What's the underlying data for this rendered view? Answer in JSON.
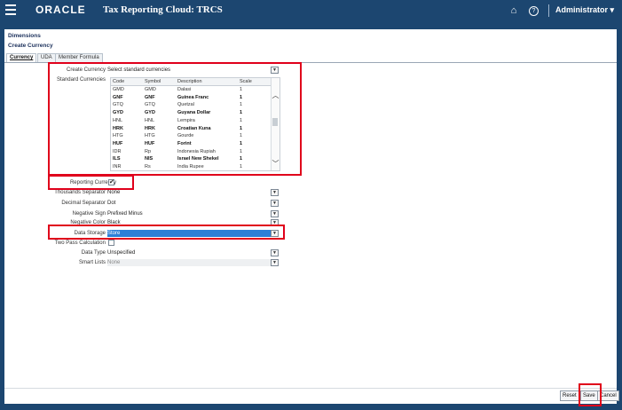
{
  "header": {
    "logo": "ORACLE",
    "app_title": "Tax Reporting Cloud: TRCS",
    "user": "Administrator ▾",
    "home_icon": "⌂",
    "help_icon": "?"
  },
  "page": {
    "section": "Dimensions",
    "title": "Create Currency"
  },
  "tabs": [
    "Currency",
    "UDA",
    "Member Formula"
  ],
  "form": {
    "create_currency_label": "Create Currency",
    "create_currency_value": "Select standard currencies",
    "standard_currencies_label": "Standard Currencies",
    "columns": [
      "Code",
      "Symbol",
      "Description",
      "Scale"
    ],
    "rows": [
      {
        "code": "GMD",
        "symbol": "GMD",
        "description": "Dalasi",
        "scale": "1",
        "bold": false
      },
      {
        "code": "GNF",
        "symbol": "GNF",
        "description": "Guinea Franc",
        "scale": "1",
        "bold": true
      },
      {
        "code": "GTQ",
        "symbol": "GTQ",
        "description": "Quetzal",
        "scale": "1",
        "bold": false
      },
      {
        "code": "GYD",
        "symbol": "GYD",
        "description": "Guyana Dollar",
        "scale": "1",
        "bold": true
      },
      {
        "code": "HNL",
        "symbol": "HNL",
        "description": "Lempira",
        "scale": "1",
        "bold": false
      },
      {
        "code": "HRK",
        "symbol": "HRK",
        "description": "Croatian Kuna",
        "scale": "1",
        "bold": true
      },
      {
        "code": "HTG",
        "symbol": "HTG",
        "description": "Gourde",
        "scale": "1",
        "bold": false
      },
      {
        "code": "HUF",
        "symbol": "HUF",
        "description": "Forint",
        "scale": "1",
        "bold": true
      },
      {
        "code": "IDR",
        "symbol": "Rp",
        "description": "Indonesia Rupiah",
        "scale": "1",
        "bold": false
      },
      {
        "code": "ILS",
        "symbol": "NIS",
        "description": "Israel New Shekel",
        "scale": "1",
        "bold": true
      },
      {
        "code": "INR",
        "symbol": "Rs",
        "description": "India Rupee",
        "scale": "1",
        "bold": false
      }
    ],
    "reporting_currency_label": "Reporting Currency",
    "reporting_currency_checked": "✔",
    "thousands_separator_label": "Thousands Separator",
    "thousands_separator_value": "None",
    "decimal_separator_label": "Decimal Separator",
    "decimal_separator_value": "Dot",
    "negative_sign_label": "Negative Sign",
    "negative_sign_value": "Prefixed Minus",
    "negative_color_label": "Negative Color",
    "negative_color_value": "Black",
    "data_storage_label": "Data Storage",
    "data_storage_value": "Store",
    "two_pass_label": "Two Pass Calculation",
    "data_type_label": "Data Type",
    "data_type_value": "Unspecified",
    "smart_lists_label": "Smart Lists",
    "smart_lists_value": "None"
  },
  "buttons": {
    "reset": "Reset",
    "save": "Save",
    "cancel": "Cancel"
  },
  "colors": {
    "header_bg": "#1c4670",
    "highlight_blue": "#2c7fd6",
    "annotation_red": "#e0001b"
  }
}
